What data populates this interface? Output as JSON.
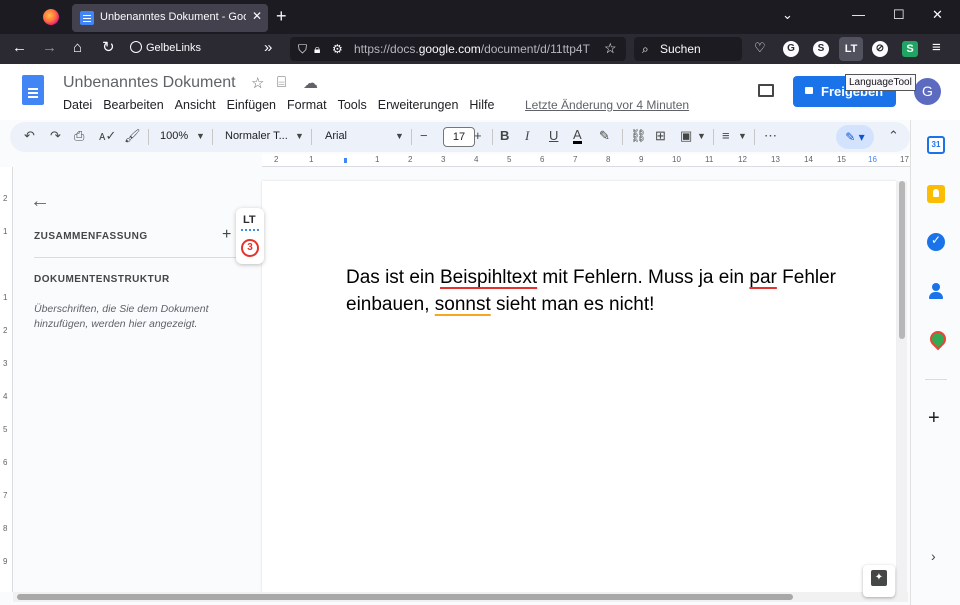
{
  "browser": {
    "tab_title": "Unbenanntes Dokument - Google Docs",
    "tab_close": "✕",
    "new_tab": "+",
    "bookmark": "GelbeLinks",
    "url_prefix": "https://docs.",
    "url_host": "google.com",
    "url_path": "/document/d/11ttp4T",
    "search_placeholder": "Suchen",
    "extension_labels": {
      "g": "G",
      "s": "S",
      "lt": "LT",
      "sheets": "S"
    },
    "tooltip": "LanguageTool"
  },
  "docs": {
    "title": "Unbenanntes Dokument",
    "menu": [
      "Datei",
      "Bearbeiten",
      "Ansicht",
      "Einfügen",
      "Format",
      "Tools",
      "Erweiterungen",
      "Hilfe"
    ],
    "last_edit": "Letzte Änderung vor 4 Minuten",
    "share_label": "Freigeben",
    "avatar_initial": "G"
  },
  "toolbar": {
    "zoom": "100%",
    "style": "Normaler T...",
    "font": "Arial",
    "font_size": "17"
  },
  "ruler": {
    "h_labels": [
      "2",
      "1",
      "1",
      "2",
      "3",
      "4",
      "5",
      "6",
      "7",
      "8",
      "9",
      "10",
      "11",
      "12",
      "13",
      "14",
      "15",
      "16",
      "17"
    ],
    "v_labels": [
      "2",
      "1",
      "1",
      "2",
      "3",
      "4",
      "5",
      "6",
      "7",
      "8",
      "9"
    ]
  },
  "outline": {
    "summary_heading": "ZUSAMMENFASSUNG",
    "add": "+",
    "structure_heading": "DOKUMENTENSTRUKTUR",
    "structure_hint": "Überschriften, die Sie dem Dokument hinzufügen, werden hier angezeigt."
  },
  "languagetool": {
    "logo": "LT",
    "issue_count": "3"
  },
  "document": {
    "segments": [
      {
        "text": "Das ist ein ",
        "error": ""
      },
      {
        "text": "Beispihltext",
        "error": "spelling"
      },
      {
        "text": " mit Fehlern. Muss ja ein ",
        "error": ""
      },
      {
        "text": "par",
        "error": "spelling"
      },
      {
        "text": " Fehler einbauen, ",
        "error": ""
      },
      {
        "text": "sonnst",
        "error": "style"
      },
      {
        "text": " sieht man es nicht!",
        "error": ""
      }
    ]
  },
  "side_panel": {
    "calendar_day": "31",
    "add": "+",
    "expand": "›"
  },
  "colors": {
    "accent": "#1a73e8",
    "spelling_underline": "#e5322d",
    "style_underline": "#f5a623"
  }
}
